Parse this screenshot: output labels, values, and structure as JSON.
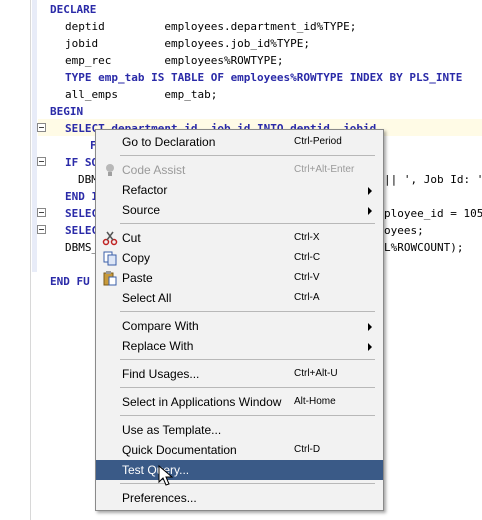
{
  "code": {
    "lines": [
      {
        "indent": "",
        "kw1": "DECLARE",
        "rest": ""
      },
      {
        "indent": "  ",
        "text": "deptid         employees.department_id%TYPE;"
      },
      {
        "indent": "  ",
        "text": "jobid          employees.job_id%TYPE;"
      },
      {
        "indent": "  ",
        "text": "emp_rec        employees%ROWTYPE;"
      },
      {
        "indent": "  ",
        "text": "TYPE emp_tab IS TABLE OF employees%ROWTYPE INDEX BY PLS_INTE"
      },
      {
        "indent": "  ",
        "text": "all_emps       emp_tab;"
      },
      {
        "indent": "",
        "text": "BEGIN"
      },
      {
        "indent": "  ",
        "text": "SELECT department_id, job_id INTO deptid, jobid"
      },
      {
        "indent": "     ",
        "text": "FR"
      },
      {
        "indent": "  ",
        "text": "IF SQ"
      },
      {
        "indent": "    ",
        "text": "DBM"
      },
      {
        "indent": "  ",
        "text": "END I"
      },
      {
        "indent": "  ",
        "text": "SELEC"
      },
      {
        "indent": "  ",
        "text": "SELEC"
      },
      {
        "indent": "  ",
        "text": "DBMS_"
      },
      {
        "indent": "",
        "text": ""
      },
      {
        "indent": "",
        "text": "END FU"
      }
    ],
    "right_fragments": {
      "line10": "|| ', Job Id: '",
      "line12": "ployee_id = 105",
      "line13": "oyees;",
      "line14": "L%ROWCOUNT);"
    }
  },
  "menu": {
    "items": [
      {
        "label": "Go to Declaration",
        "shortcut": "Ctrl-Period"
      },
      {
        "label": "Code Assist",
        "shortcut": "Ctrl+Alt-Enter",
        "disabled": true,
        "icon": "lightbulb-icon"
      },
      {
        "label": "Refactor",
        "submenu": true
      },
      {
        "label": "Source",
        "submenu": true
      },
      {
        "label": "Cut",
        "shortcut": "Ctrl-X",
        "icon": "scissors-icon"
      },
      {
        "label": "Copy",
        "shortcut": "Ctrl-C",
        "icon": "copy-icon"
      },
      {
        "label": "Paste",
        "shortcut": "Ctrl-V",
        "icon": "paste-icon"
      },
      {
        "label": "Select All",
        "shortcut": "Ctrl-A"
      },
      {
        "label": "Compare With",
        "submenu": true
      },
      {
        "label": "Replace With",
        "submenu": true
      },
      {
        "label": "Find Usages...",
        "shortcut": "Ctrl+Alt-U"
      },
      {
        "label": "Select in Applications Window",
        "shortcut": "Alt-Home"
      },
      {
        "label": "Use as Template..."
      },
      {
        "label": "Quick Documentation",
        "shortcut": "Ctrl-D"
      },
      {
        "label": "Test Query...",
        "selected": true
      },
      {
        "label": "Preferences..."
      }
    ]
  },
  "colors": {
    "keyword": "#2a2aa8",
    "menu_selected_bg": "#3a5a87",
    "menu_bg": "#f2f2f2"
  }
}
